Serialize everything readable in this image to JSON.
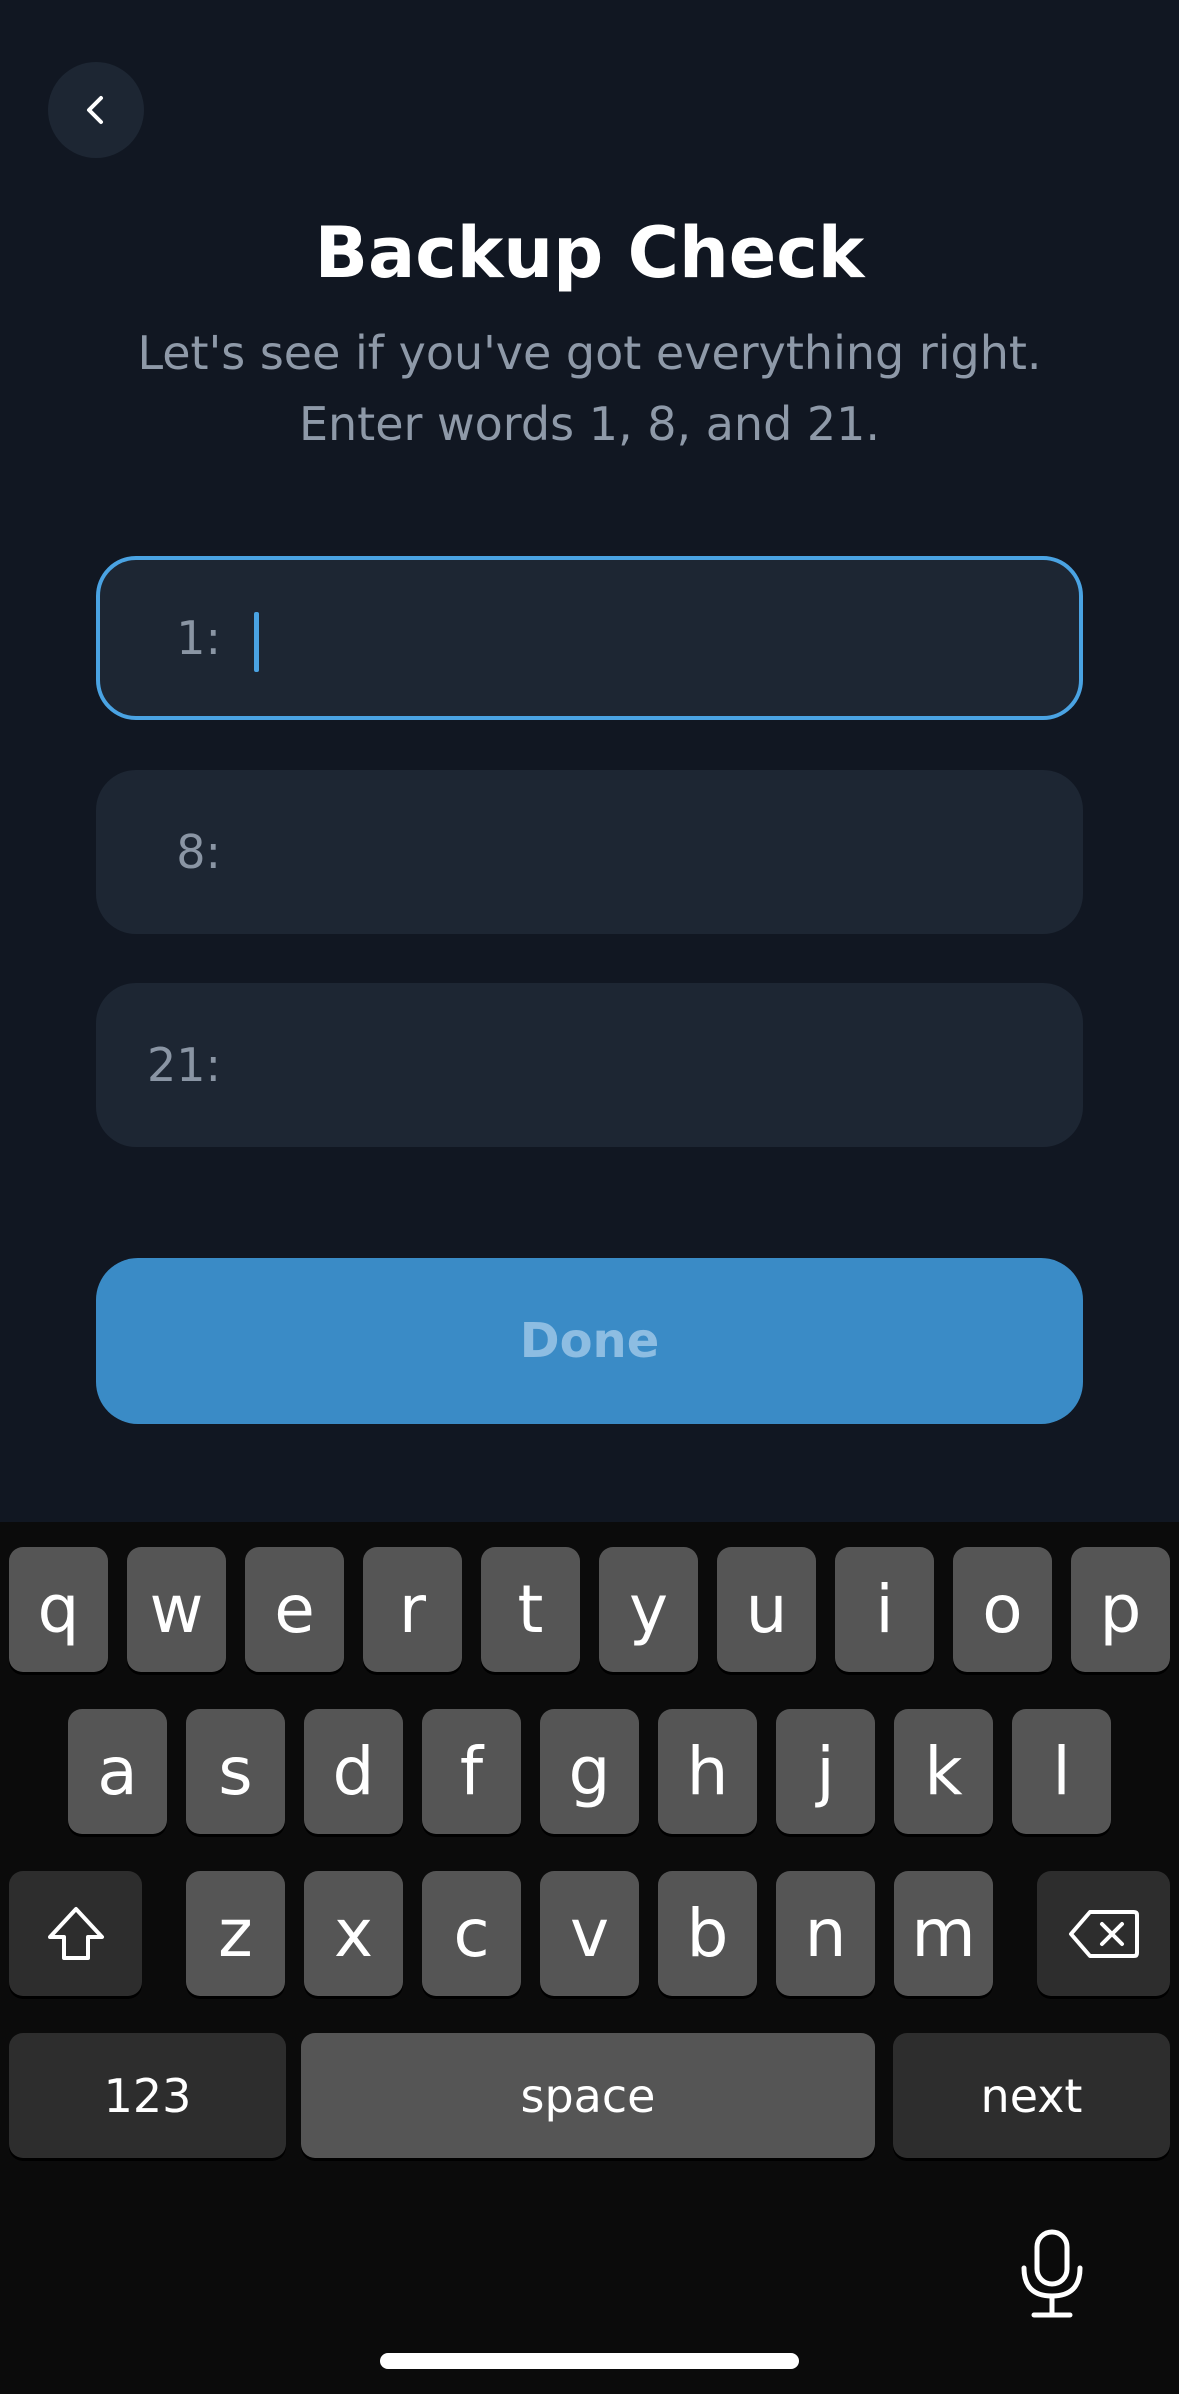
{
  "header": {
    "back_icon": "chevron-left-icon",
    "title": "Backup Check",
    "subtitle_line1": "Let's see if you've got everything right.",
    "subtitle_line2": "Enter words 1, 8, and 21."
  },
  "fields": [
    {
      "label": "1:",
      "value": "",
      "focused": true
    },
    {
      "label": "8:",
      "value": ""
    },
    {
      "label": "21:",
      "value": ""
    }
  ],
  "done_label": "Done",
  "keyboard": {
    "row1": [
      "q",
      "w",
      "e",
      "r",
      "t",
      "y",
      "u",
      "i",
      "o",
      "p"
    ],
    "row2": [
      "a",
      "s",
      "d",
      "f",
      "g",
      "h",
      "j",
      "k",
      "l"
    ],
    "row3": [
      "z",
      "x",
      "c",
      "v",
      "b",
      "n",
      "m"
    ],
    "shift_icon": "shift-icon",
    "backspace_icon": "backspace-icon",
    "numbers_label": "123",
    "space_label": "space",
    "next_label": "next",
    "mic_icon": "microphone-icon"
  },
  "colors": {
    "background": "#111722",
    "field": "#1d2633",
    "accent": "#4aa3e3",
    "done_button": "#3a8bc6"
  }
}
